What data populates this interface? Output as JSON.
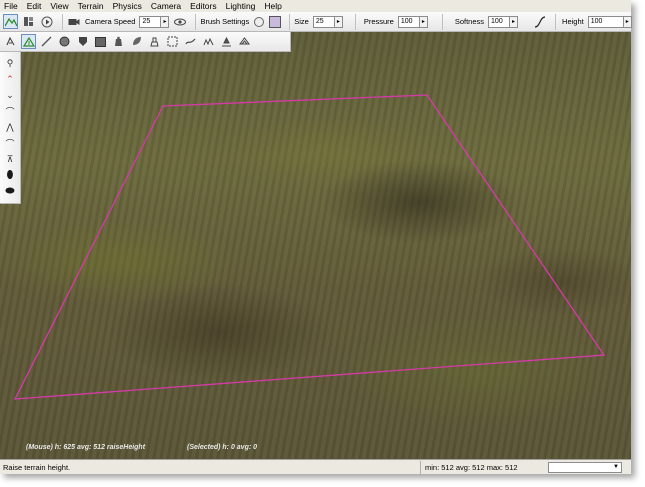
{
  "menu": [
    "File",
    "Edit",
    "View",
    "Terrain",
    "Physics",
    "Camera",
    "Editors",
    "Lighting",
    "Help"
  ],
  "toolbar": {
    "camera_speed_label": "Camera Speed",
    "camera_speed_value": "25",
    "brush_settings_label": "Brush Settings",
    "size_label": "Size",
    "size_value": "25",
    "pressure_label": "Pressure",
    "pressure_value": "100",
    "softness_label": "Softness",
    "softness_value": "100",
    "height_label": "Height",
    "height_value": "100",
    "swatch_color": "#c9b9dc"
  },
  "viewport": {
    "mouse_info": "(Mouse) h: 625  avg: 512 raiseHeight",
    "selected_info": "(Selected) h: 0  avg: 0",
    "selection_color": "#d63aa8"
  },
  "status": {
    "message": "Raise terrain height.",
    "stats": "min: 512  avg: 512  max: 512",
    "combo_value": ""
  }
}
